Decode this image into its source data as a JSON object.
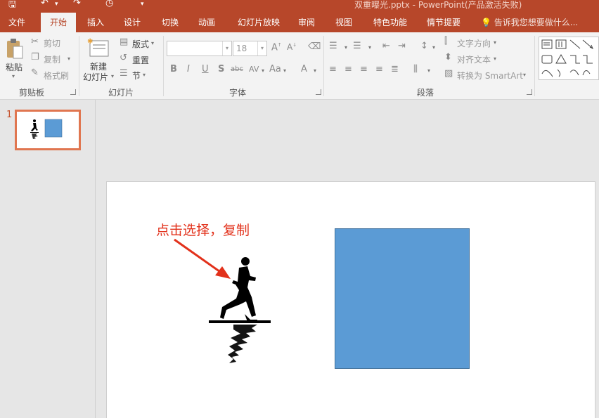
{
  "window": {
    "title": "双重曝光.pptx - PowerPoint(产品激活失败)"
  },
  "quick_access": {
    "icons": [
      "save-icon",
      "undo-icon",
      "redo-icon",
      "present-icon",
      "customize-icon"
    ]
  },
  "tabs": [
    {
      "label": "文件"
    },
    {
      "label": "开始",
      "active": true
    },
    {
      "label": "插入"
    },
    {
      "label": "设计"
    },
    {
      "label": "切换"
    },
    {
      "label": "动画"
    },
    {
      "label": "幻灯片放映"
    },
    {
      "label": "审阅"
    },
    {
      "label": "视图"
    },
    {
      "label": "特色功能"
    },
    {
      "label": "情节提要"
    }
  ],
  "tell_me": {
    "placeholder": "告诉我您想要做什么..."
  },
  "ribbon": {
    "clipboard": {
      "label": "剪贴板",
      "paste": "粘贴",
      "cut": "剪切",
      "copy": "复制",
      "format_painter": "格式刷"
    },
    "slides": {
      "label": "幻灯片",
      "new_slide_line1": "新建",
      "new_slide_line2": "幻灯片",
      "layout": "版式",
      "reset": "重置",
      "section": "节"
    },
    "font": {
      "label": "字体",
      "font_name": "",
      "font_size": "18",
      "bold": "B",
      "italic": "I",
      "underline": "U",
      "shadow": "S",
      "strike": "abc",
      "spacing": "AV",
      "case": "Aa",
      "color": "A"
    },
    "paragraph": {
      "label": "段落",
      "text_direction": "文字方向",
      "align_text": "对齐文本",
      "convert_smartart": "转换为 SmartArt"
    }
  },
  "slides_panel": {
    "items": [
      {
        "number": "1"
      }
    ]
  },
  "slide": {
    "callout_text": "点击选择，复制",
    "callout_color": "#e2311b",
    "shape_color": "#5b9bd5"
  },
  "colors": {
    "brand": "#b7472a",
    "active_tab_text": "#b7472a",
    "thumb_border": "#e07650"
  }
}
